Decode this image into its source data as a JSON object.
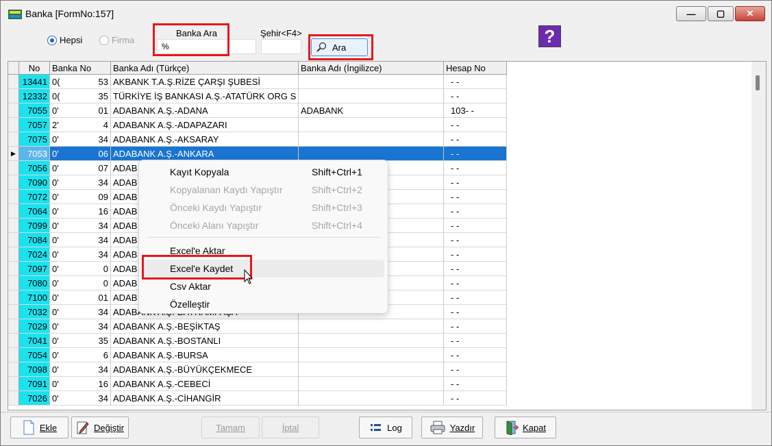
{
  "window": {
    "title": "Banka [FormNo:157]",
    "minimize": "—",
    "maximize": "▢",
    "close": "✕"
  },
  "filters": {
    "radio_all": "Hepsi",
    "radio_firm": "Firma",
    "bank_search_label": "Banka Ara",
    "bank_search_value": "%",
    "city_label": "Şehir<F4>",
    "city_value": "",
    "search_button": "Ara",
    "help": "?"
  },
  "grid": {
    "columns": [
      "No",
      "Banka No",
      "Banka Adı (Türkçe)",
      "Banka Adı (İngilizce)",
      "Hesap No"
    ],
    "rows": [
      {
        "no": "13441",
        "bno_left": "0(",
        "bno_right": "53",
        "name": "AKBANK T.A.Ş.RİZE ÇARŞI ŞUBESİ",
        "eng": "",
        "hesap": "- -"
      },
      {
        "no": "12332",
        "bno_left": "0(",
        "bno_right": "35",
        "name": "TÜRKİYE İŞ BANKASI A.Ş.-ATATÜRK ORG S",
        "eng": "",
        "hesap": "- -"
      },
      {
        "no": "7055",
        "bno_left": "0'",
        "bno_right": "01",
        "name": "ADABANK A.Ş.-ADANA",
        "eng": "ADABANK",
        "hesap": "103- -"
      },
      {
        "no": "7057",
        "bno_left": "2'",
        "bno_right": "4",
        "name": "ADABANK A.Ş.-ADAPAZARI",
        "eng": "",
        "hesap": "- -"
      },
      {
        "no": "7075",
        "bno_left": "0'",
        "bno_right": "34",
        "name": "ADABANK A.Ş.-AKSARAY",
        "eng": "",
        "hesap": "- -"
      },
      {
        "no": "7053",
        "bno_left": "0'",
        "bno_right": "06",
        "name": "ADABANK A.Ş.-ANKARA",
        "eng": "",
        "hesap": "- -",
        "selected": true
      },
      {
        "no": "7056",
        "bno_left": "0'",
        "bno_right": "07",
        "name": "ADAB",
        "eng": "",
        "hesap": "- -"
      },
      {
        "no": "7090",
        "bno_left": "0'",
        "bno_right": "34",
        "name": "ADAB",
        "eng": "",
        "hesap": "- -"
      },
      {
        "no": "7072",
        "bno_left": "0'",
        "bno_right": "09",
        "name": "ADAB",
        "eng": "",
        "hesap": "- -"
      },
      {
        "no": "7064",
        "bno_left": "0'",
        "bno_right": "16",
        "name": "ADAB",
        "eng": "",
        "hesap": "- -"
      },
      {
        "no": "7099",
        "bno_left": "0'",
        "bno_right": "34",
        "name": "ADAB",
        "eng": "",
        "hesap": "- -"
      },
      {
        "no": "7084",
        "bno_left": "0'",
        "bno_right": "34",
        "name": "ADAB",
        "eng": "",
        "hesap": "- -"
      },
      {
        "no": "7024",
        "bno_left": "0'",
        "bno_right": "34",
        "name": "ADAB",
        "eng": "",
        "hesap": "- -"
      },
      {
        "no": "7097",
        "bno_left": "0'",
        "bno_right": "0",
        "name": "ADAB",
        "eng": "",
        "hesap": "- -"
      },
      {
        "no": "7080",
        "bno_left": "0'",
        "bno_right": "0",
        "name": "ADAB",
        "eng": "",
        "hesap": "- -"
      },
      {
        "no": "7100",
        "bno_left": "0'",
        "bno_right": "01",
        "name": "ADAB",
        "eng": "",
        "hesap": "- -"
      },
      {
        "no": "7032",
        "bno_left": "0'",
        "bno_right": "34",
        "name": "ADABANK A.Ş.-BAYRAMPAŞA",
        "eng": "",
        "hesap": "- -"
      },
      {
        "no": "7029",
        "bno_left": "0'",
        "bno_right": "34",
        "name": "ADABANK A.Ş.-BEŞİKTAŞ",
        "eng": "",
        "hesap": "- -"
      },
      {
        "no": "7041",
        "bno_left": "0'",
        "bno_right": "35",
        "name": "ADABANK A.Ş.-BOSTANLI",
        "eng": "",
        "hesap": "- -"
      },
      {
        "no": "7054",
        "bno_left": "0'",
        "bno_right": "6",
        "name": "ADABANK A.Ş.-BURSA",
        "eng": "",
        "hesap": "- -"
      },
      {
        "no": "7098",
        "bno_left": "0'",
        "bno_right": "34",
        "name": "ADABANK A.Ş.-BÜYÜKÇEKMECE",
        "eng": "",
        "hesap": "- -"
      },
      {
        "no": "7091",
        "bno_left": "0'",
        "bno_right": "16",
        "name": "ADABANK A.Ş.-CEBECİ",
        "eng": "",
        "hesap": "- -"
      },
      {
        "no": "7026",
        "bno_left": "0'",
        "bno_right": "34",
        "name": "ADABANK A.Ş.-CİHANGİR",
        "eng": "",
        "hesap": "- -"
      }
    ]
  },
  "context_menu": {
    "items": [
      {
        "label": "Kayıt Kopyala",
        "shortcut": "Shift+Ctrl+1"
      },
      {
        "label": "Kopyalanan Kaydı Yapıştır",
        "shortcut": "Shift+Ctrl+2"
      },
      {
        "label": "Önceki Kaydı Yapıştır",
        "shortcut": "Shift+Ctrl+3"
      },
      {
        "label": "Önceki Alanı Yapıştır",
        "shortcut": "Shift+Ctrl+4"
      },
      {
        "label": "Excel'e Aktar",
        "shortcut": ""
      },
      {
        "label": "Excel'e Kaydet",
        "shortcut": ""
      },
      {
        "label": "Csv Aktar",
        "shortcut": ""
      },
      {
        "label": "Özelleştir",
        "shortcut": ""
      }
    ]
  },
  "bottom_bar": {
    "add": "Ekle",
    "edit": "Değiştir",
    "ok": "Tamam",
    "cancel": "İptal",
    "log": "Log",
    "print": "Yazdır",
    "close": "Kapat"
  },
  "colors": {
    "highlight_red": "#e8161c",
    "selected_row": "#1974d2",
    "no_column": "#19e3ef",
    "help_purple": "#6c2ab0"
  }
}
